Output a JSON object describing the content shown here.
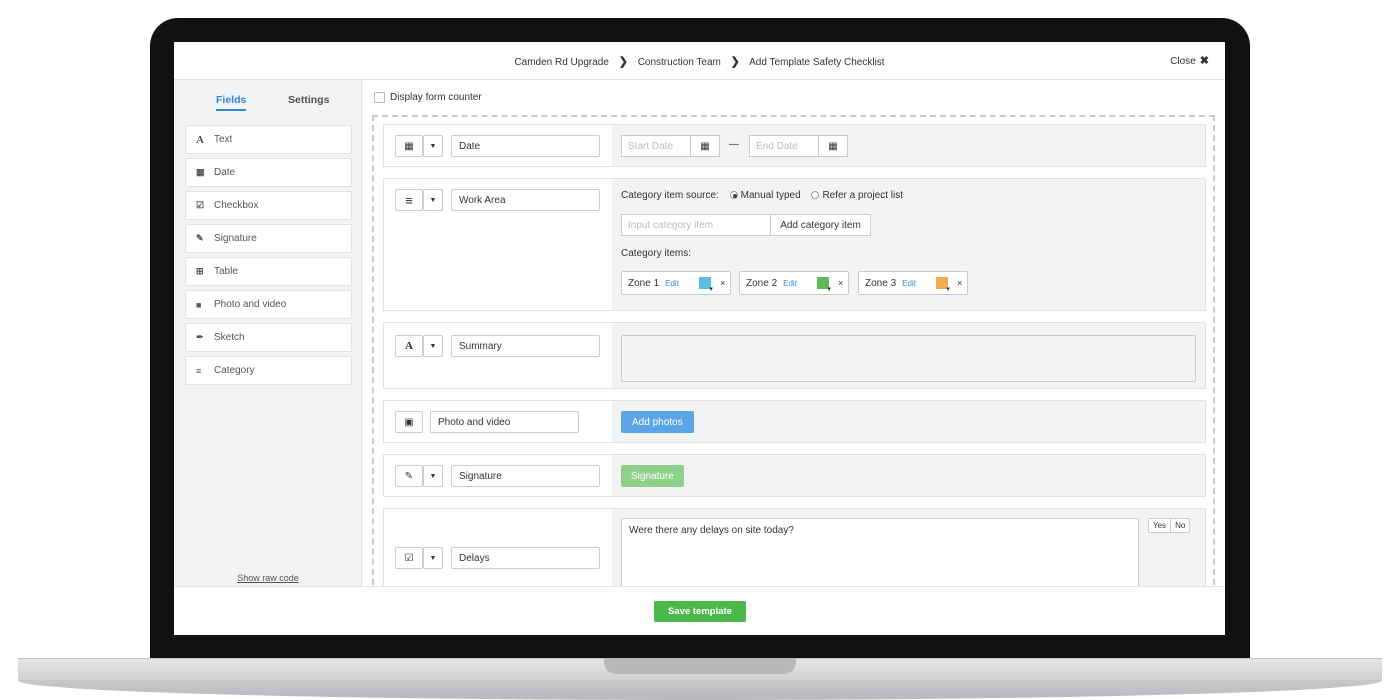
{
  "header": {
    "breadcrumb": [
      "Camden Rd Upgrade",
      "Construction Team",
      "Add Template Safety Checklist"
    ],
    "close_label": "Close"
  },
  "sidebar": {
    "tabs": [
      {
        "label": "Fields",
        "active": true
      },
      {
        "label": "Settings",
        "active": false
      }
    ],
    "items": [
      {
        "label": "Text",
        "icon": "text-icon"
      },
      {
        "label": "Date",
        "icon": "calendar-icon"
      },
      {
        "label": "Checkbox",
        "icon": "checkbox-icon"
      },
      {
        "label": "Signature",
        "icon": "pencil-icon"
      },
      {
        "label": "Table",
        "icon": "table-icon"
      },
      {
        "label": "Photo and video",
        "icon": "camera-icon"
      },
      {
        "label": "Sketch",
        "icon": "brush-icon"
      },
      {
        "label": "Category",
        "icon": "list-icon"
      }
    ],
    "show_raw_code": "Show raw code"
  },
  "main": {
    "display_form_counter": "Display form counter",
    "fields": {
      "date": {
        "name": "Date",
        "start_placeholder": "Start Date",
        "end_placeholder": "End Date",
        "range_sep": "—"
      },
      "work_area": {
        "name": "Work Area",
        "source_label": "Category item source:",
        "source_options": [
          "Manual typed",
          "Refer a project list"
        ],
        "source_selected": "Manual typed",
        "input_placeholder": "Input category item",
        "add_button": "Add category item",
        "items_label": "Category items:",
        "items": [
          {
            "label": "Zone 1",
            "edit": "Edit",
            "color": "#5bc0de"
          },
          {
            "label": "Zone 2",
            "edit": "Edit",
            "color": "#5cb85c"
          },
          {
            "label": "Zone 3",
            "edit": "Edit",
            "color": "#f0ad4e"
          }
        ],
        "remove": "×"
      },
      "summary": {
        "name": "Summary"
      },
      "photo": {
        "name": "Photo and video",
        "button": "Add photos"
      },
      "signature": {
        "name": "Signature",
        "button": "Signature"
      },
      "delays": {
        "name": "Delays",
        "question": "Were there any delays on site today?",
        "yes": "Yes",
        "no": "No"
      }
    }
  },
  "footer": {
    "save_label": "Save template"
  },
  "colors": {
    "accent": "#2b8ad8",
    "save": "#4cb84c",
    "primary_button": "#5aa5e6",
    "signature_button": "#8fd18a"
  }
}
